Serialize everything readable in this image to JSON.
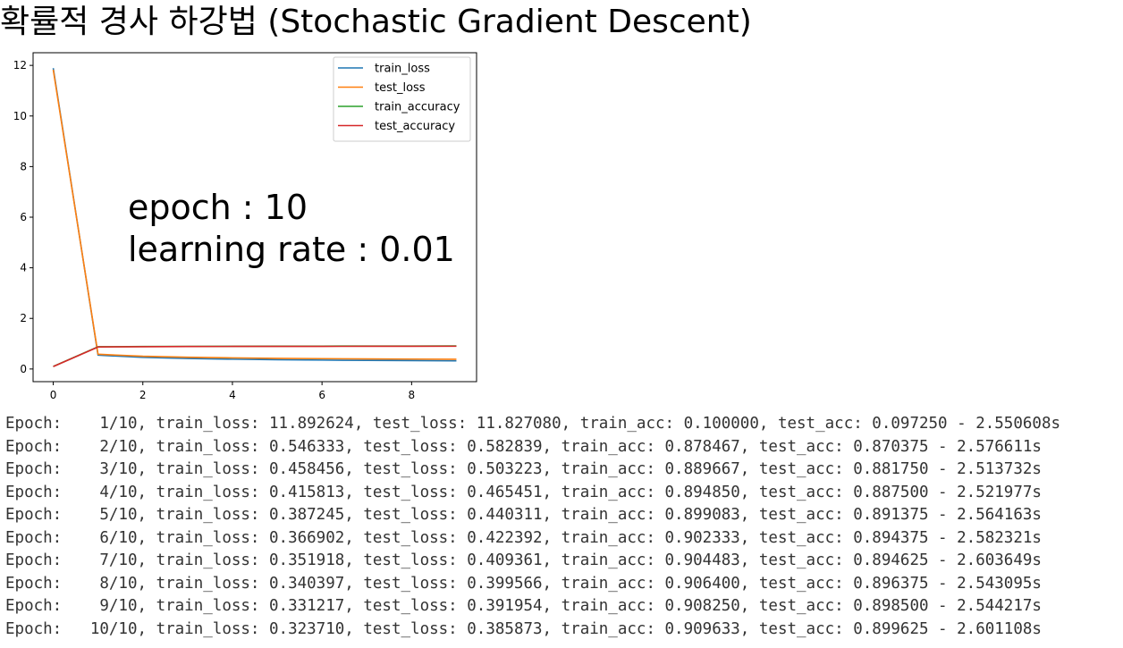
{
  "page": {
    "title": "확률적 경사 하강법 (Stochastic Gradient Descent)"
  },
  "chart_data": {
    "type": "line",
    "x": [
      0,
      1,
      2,
      3,
      4,
      5,
      6,
      7,
      8,
      9
    ],
    "series": [
      {
        "name": "train_loss",
        "color": "#1f77b4",
        "values": [
          11.892624,
          0.546333,
          0.458456,
          0.415813,
          0.387245,
          0.366902,
          0.351918,
          0.340397,
          0.331217,
          0.32371
        ]
      },
      {
        "name": "test_loss",
        "color": "#ff7f0e",
        "values": [
          11.82708,
          0.582839,
          0.503223,
          0.465451,
          0.440311,
          0.422392,
          0.409361,
          0.399566,
          0.391954,
          0.385873
        ]
      },
      {
        "name": "train_accuracy",
        "color": "#2ca02c",
        "values": [
          0.1,
          0.878467,
          0.889667,
          0.89485,
          0.899083,
          0.902333,
          0.904483,
          0.9064,
          0.90825,
          0.909633
        ]
      },
      {
        "name": "test_accuracy",
        "color": "#d62728",
        "values": [
          0.09725,
          0.870375,
          0.88175,
          0.8875,
          0.891375,
          0.894375,
          0.894625,
          0.896375,
          0.8985,
          0.899625
        ]
      }
    ],
    "x_ticks": [
      "0",
      "2",
      "4",
      "6",
      "8"
    ],
    "y_ticks": [
      "0",
      "2",
      "4",
      "6",
      "8",
      "10",
      "12"
    ],
    "xlim": [
      -0.45,
      9.45
    ],
    "ylim": [
      -0.5,
      12.5
    ],
    "grid": false,
    "legend_position": "top-right",
    "annotation_lines": [
      "epoch : 10",
      "learning rate : 0.01"
    ]
  },
  "log_lines": [
    "Epoch:    1/10, train_loss: 11.892624, test_loss: 11.827080, train_acc: 0.100000, test_acc: 0.097250 - 2.550608s",
    "Epoch:    2/10, train_loss: 0.546333, test_loss: 0.582839, train_acc: 0.878467, test_acc: 0.870375 - 2.576611s",
    "Epoch:    3/10, train_loss: 0.458456, test_loss: 0.503223, train_acc: 0.889667, test_acc: 0.881750 - 2.513732s",
    "Epoch:    4/10, train_loss: 0.415813, test_loss: 0.465451, train_acc: 0.894850, test_acc: 0.887500 - 2.521977s",
    "Epoch:    5/10, train_loss: 0.387245, test_loss: 0.440311, train_acc: 0.899083, test_acc: 0.891375 - 2.564163s",
    "Epoch:    6/10, train_loss: 0.366902, test_loss: 0.422392, train_acc: 0.902333, test_acc: 0.894375 - 2.582321s",
    "Epoch:    7/10, train_loss: 0.351918, test_loss: 0.409361, train_acc: 0.904483, test_acc: 0.894625 - 2.603649s",
    "Epoch:    8/10, train_loss: 0.340397, test_loss: 0.399566, train_acc: 0.906400, test_acc: 0.896375 - 2.543095s",
    "Epoch:    9/10, train_loss: 0.331217, test_loss: 0.391954, train_acc: 0.908250, test_acc: 0.898500 - 2.544217s",
    "Epoch:   10/10, train_loss: 0.323710, test_loss: 0.385873, train_acc: 0.909633, test_acc: 0.899625 - 2.601108s"
  ]
}
